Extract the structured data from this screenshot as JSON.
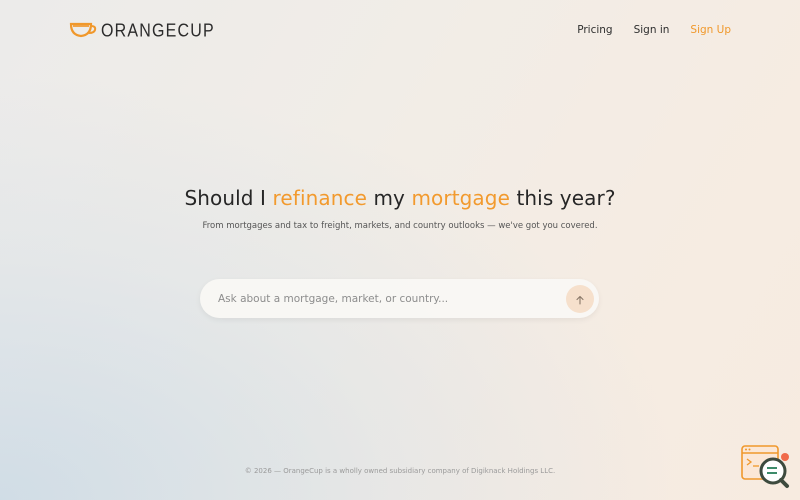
{
  "brand": {
    "name": "ORANGECUP",
    "accent": "#f0982b"
  },
  "nav": {
    "items": [
      {
        "label": "Pricing"
      },
      {
        "label": "Sign in"
      },
      {
        "label": "Sign Up"
      }
    ]
  },
  "hero": {
    "headline_parts": [
      "Should I ",
      "refinance",
      " my ",
      "mortgage",
      " this year?"
    ],
    "subline": "From mortgages and tax to freight, markets, and country outlooks — we've got you covered."
  },
  "search": {
    "placeholder": "Ask about a mortgage, market, or country...",
    "submit_icon": "arrow-up-icon"
  },
  "footer": {
    "text": "© 2026 — OrangeCup is a wholly owned subsidiary company of Digiknack Holdings LLC."
  },
  "widget": {
    "icon": "search-assistant-icon"
  }
}
